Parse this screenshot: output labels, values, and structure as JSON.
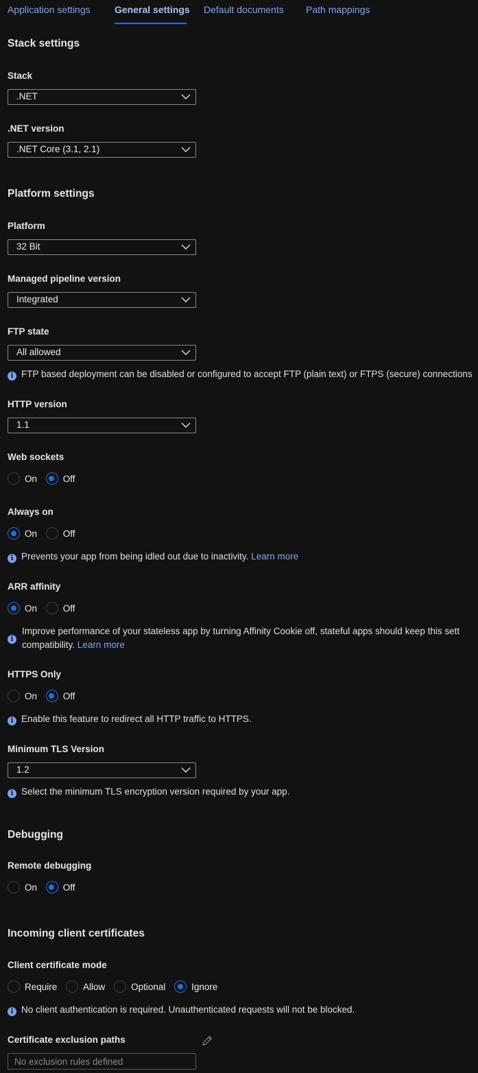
{
  "tabs": [
    {
      "label": "Application settings",
      "active": false
    },
    {
      "label": "General settings",
      "active": true
    },
    {
      "label": "Default documents",
      "active": false
    },
    {
      "label": "Path mappings",
      "active": false
    }
  ],
  "colors": {
    "accent": "#1f6fe0",
    "link": "#7ea7ef",
    "background": "#121212"
  },
  "stack_settings": {
    "title": "Stack settings",
    "stack": {
      "label": "Stack",
      "value": ".NET"
    },
    "net_version": {
      "label": ".NET version",
      "value": ".NET Core (3.1, 2.1)"
    }
  },
  "platform_settings": {
    "title": "Platform settings",
    "platform": {
      "label": "Platform",
      "value": "32 Bit"
    },
    "pipeline": {
      "label": "Managed pipeline version",
      "value": "Integrated"
    },
    "ftp_state": {
      "label": "FTP state",
      "value": "All allowed",
      "info": "FTP based deployment can be disabled or configured to accept FTP (plain text) or FTPS (secure) connections"
    },
    "http_version": {
      "label": "HTTP version",
      "value": "1.1"
    },
    "web_sockets": {
      "label": "Web sockets",
      "options": [
        "On",
        "Off"
      ],
      "selected": "Off"
    },
    "always_on": {
      "label": "Always on",
      "options": [
        "On",
        "Off"
      ],
      "selected": "On",
      "info": "Prevents your app from being idled out due to inactivity.",
      "link": "Learn more"
    },
    "arr_affinity": {
      "label": "ARR affinity",
      "options": [
        "On",
        "Off"
      ],
      "selected": "On",
      "info_line1": "Improve performance of your stateless app by turning Affinity Cookie off, stateful apps should keep this sett",
      "info_line2": "compatibility.",
      "link": "Learn more"
    },
    "https_only": {
      "label": "HTTPS Only",
      "options": [
        "On",
        "Off"
      ],
      "selected": "Off",
      "info": "Enable this feature to redirect all HTTP traffic to HTTPS."
    },
    "min_tls": {
      "label": "Minimum TLS Version",
      "value": "1.2",
      "info": "Select the minimum TLS encryption version required by your app."
    }
  },
  "debugging": {
    "title": "Debugging",
    "remote_debugging": {
      "label": "Remote debugging",
      "options": [
        "On",
        "Off"
      ],
      "selected": "Off"
    }
  },
  "client_certs": {
    "title": "Incoming client certificates",
    "mode": {
      "label": "Client certificate mode",
      "options": [
        "Require",
        "Allow",
        "Optional",
        "Ignore"
      ],
      "selected": "Ignore",
      "info": "No client authentication is required. Unauthenticated requests will not be blocked."
    },
    "exclusion": {
      "label": "Certificate exclusion paths",
      "placeholder": "No exclusion rules defined",
      "value": ""
    }
  }
}
